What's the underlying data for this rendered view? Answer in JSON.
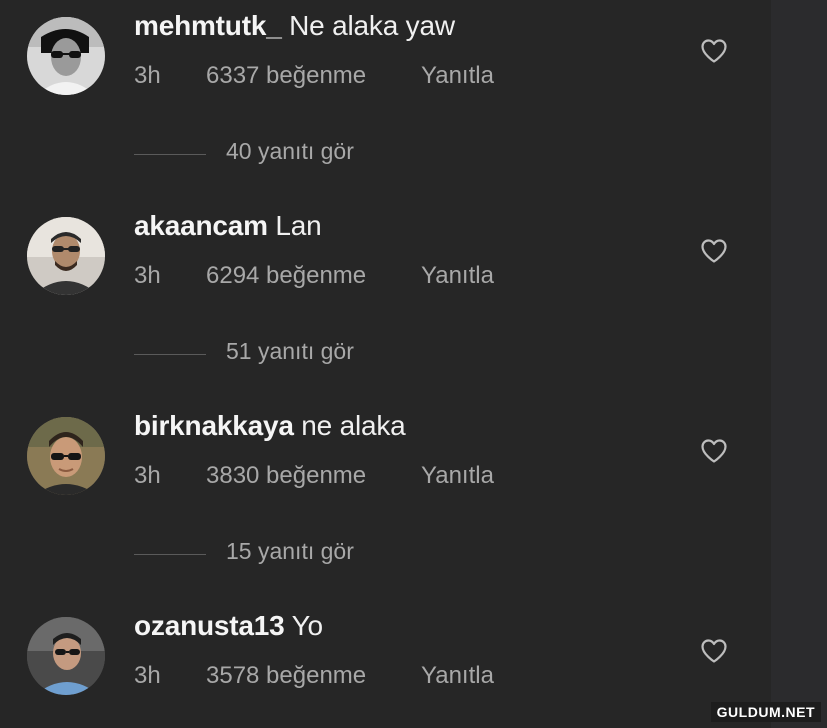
{
  "comments": [
    {
      "username": "mehmtutk_",
      "text": " Ne alaka yaw",
      "time": "3h",
      "likes": "6337 beğenme",
      "reply_label": "Yanıtla",
      "view_replies": "40 yanıtı gör",
      "avatar_icon": "profile-photo-icon",
      "heart_icon": "heart-outline-icon"
    },
    {
      "username": "akaancam",
      "text": " Lan",
      "time": "3h",
      "likes": "6294 beğenme",
      "reply_label": "Yanıtla",
      "view_replies": "51 yanıtı gör",
      "avatar_icon": "profile-photo-icon",
      "heart_icon": "heart-outline-icon"
    },
    {
      "username": "birknakkaya",
      "text": " ne alaka",
      "time": "3h",
      "likes": "3830 beğenme",
      "reply_label": "Yanıtla",
      "view_replies": "15 yanıtı gör",
      "avatar_icon": "profile-photo-icon",
      "heart_icon": "heart-outline-icon"
    },
    {
      "username": "ozanusta13",
      "text": " Yo",
      "time": "3h",
      "likes": "3578 beğenme",
      "reply_label": "Yanıtla",
      "avatar_icon": "profile-photo-icon",
      "heart_icon": "heart-outline-icon"
    }
  ],
  "watermark": "GULDUM.NET",
  "colors": {
    "background": "#262626",
    "text_primary": "#f5f5f5",
    "text_secondary": "#a8a8a8"
  }
}
